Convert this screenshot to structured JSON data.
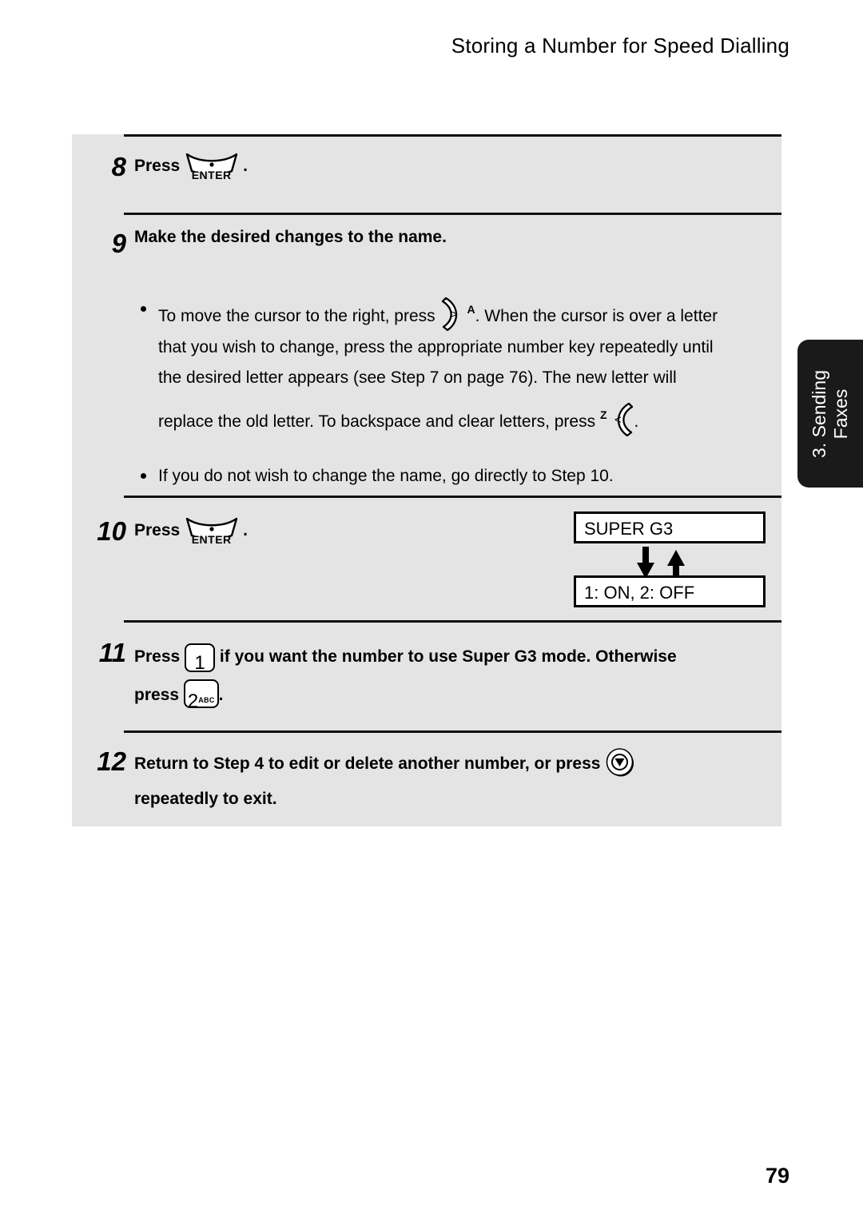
{
  "header": {
    "title": "Storing a Number for Speed Dialling"
  },
  "side_tab": {
    "line1": "3. Sending",
    "line2": "Faxes"
  },
  "page_number": "79",
  "keys": {
    "enter_label": "ENTER",
    "right_arrow_glyph": ">",
    "right_arrow_sup": "A",
    "left_arrow_glyph": "<",
    "left_arrow_sup": "Z",
    "num_one": "1",
    "num_two": "2",
    "num_two_letters": "ABC",
    "stop_name": "stop-key"
  },
  "steps": [
    {
      "number": "8",
      "press_label": "Press",
      "trailing": "."
    },
    {
      "number": "9",
      "heading": "Make the desired changes to the name.",
      "bullets": [
        {
          "part1": "To move the cursor to the right, press",
          "part2": ". When the cursor is over a letter",
          "line2": "that you wish to change, press the appropriate number key repeatedly until",
          "line3": "the desired letter appears (see Step 7 on page 76). The new letter will",
          "line4a": "replace the old letter. To backspace and clear letters, press",
          "line4b": "."
        },
        {
          "text": "If you do not wish to change the name, go directly to Step 10."
        }
      ]
    },
    {
      "number": "10",
      "press_label": "Press",
      "trailing": ".",
      "display": {
        "top_box": "SUPER G3",
        "bottom_box": "1: ON, 2: OFF"
      }
    },
    {
      "number": "11",
      "text_a": "Press",
      "text_b": "if you want the number to use Super G3 mode. Otherwise",
      "text_c": "press",
      "text_d": "."
    },
    {
      "number": "12",
      "text_a": "Return to Step 4 to edit or delete another number, or press",
      "text_b": "repeatedly to exit."
    }
  ],
  "colors": {
    "panel_bg": "#e4e4e4",
    "tab_bg": "#1a1a1a",
    "rule": "#111111",
    "lcd_bg": "#ffffff"
  }
}
